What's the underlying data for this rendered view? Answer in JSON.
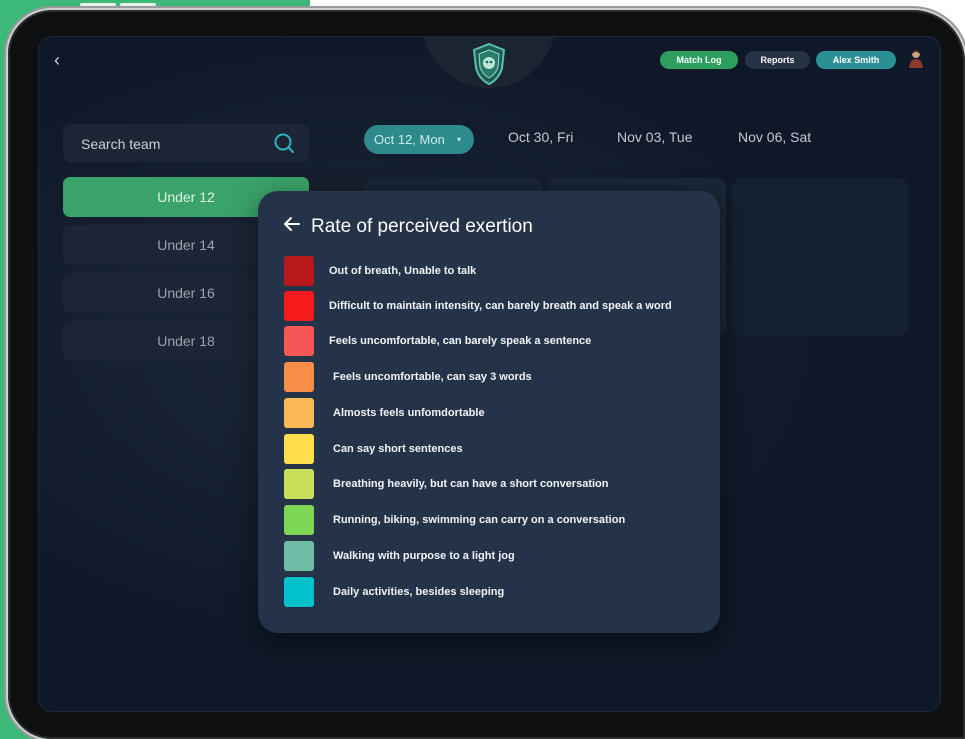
{
  "header": {
    "nav": [
      {
        "label": "Match Log",
        "color": "#2e9e5e"
      },
      {
        "label": "Reports",
        "color": "#263245"
      },
      {
        "label": "Alex Smith",
        "color": "#2d8f96"
      }
    ]
  },
  "sidebar": {
    "search_placeholder": "Search team",
    "teams": [
      {
        "label": "Under 12",
        "active": true
      },
      {
        "label": "Under 14",
        "active": false
      },
      {
        "label": "Under 16",
        "active": false
      },
      {
        "label": "Under 18",
        "active": false
      }
    ]
  },
  "dates": {
    "selected": "Oct 12, Mon",
    "items": [
      "Oct 30, Fri",
      "Nov 03, Tue",
      "Nov 06, Sat"
    ]
  },
  "modal": {
    "title": "Rate of perceived exertion",
    "levels": [
      {
        "color": "#b7191a",
        "label": "Out of breath, Unable to talk"
      },
      {
        "color": "#f51b1c",
        "label": "Difficult to maintain intensity, can barely breath and speak a word"
      },
      {
        "color": "#f55656",
        "label": "Feels uncomfortable, can barely speak a sentence"
      },
      {
        "color": "#f78e48",
        "label": "Feels uncomfortable, can say 3 words"
      },
      {
        "color": "#fbb856",
        "label": "Almosts feels unfomdortable"
      },
      {
        "color": "#ffde4e",
        "label": "Can say short sentences"
      },
      {
        "color": "#c9df5c",
        "label": "Breathing  heavily, but can have a short conversation"
      },
      {
        "color": "#7fd653",
        "label": "Running, biking, swimming can carry on a conversation"
      },
      {
        "color": "#6fbda6",
        "label": "Walking with purpose to a light jog"
      },
      {
        "color": "#00c1cc",
        "label": "Daily activities, besides sleeping"
      }
    ]
  }
}
